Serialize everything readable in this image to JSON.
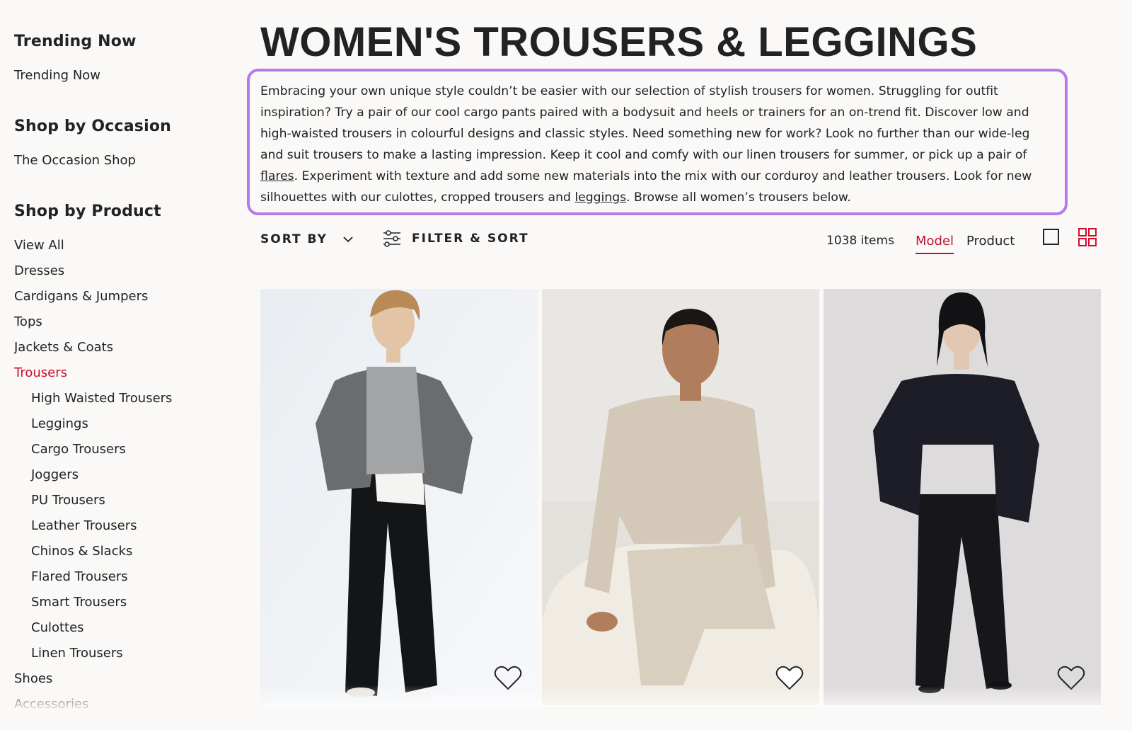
{
  "sidebar": {
    "sections": [
      {
        "heading": "Trending Now",
        "items": [
          "Trending Now"
        ]
      },
      {
        "heading": "Shop by Occasion",
        "items": [
          "The Occasion Shop"
        ]
      },
      {
        "heading": "Shop by Product",
        "items": [
          "View All",
          "Dresses",
          "Cardigans & Jumpers",
          "Tops",
          "Jackets & Coats",
          "Trousers"
        ]
      }
    ],
    "active_item": "Trousers",
    "sub_items": [
      "High Waisted Trousers",
      "Leggings",
      "Cargo Trousers",
      "Joggers",
      "PU Trousers",
      "Leather Trousers",
      "Chinos & Slacks",
      "Flared Trousers",
      "Smart Trousers",
      "Culottes",
      "Linen Trousers"
    ],
    "after_items": [
      "Shoes",
      "Accessories"
    ]
  },
  "page": {
    "title": "WOMEN'S TROUSERS & LEGGINGS",
    "description_part1": "Embracing your own unique style couldn’t be easier with our selection of stylish trousers for women. Struggling for outfit inspiration? Try a pair of our cool cargo pants paired with a bodysuit and heels or trainers for an on-trend fit. Discover low and high-waisted trousers in colourful designs and classic styles. Need something new for work? Look no further than our wide-leg and suit trousers to make a lasting impression. Keep it cool and comfy with our linen trousers for summer, or pick up a pair of ",
    "link_flares": "flares",
    "description_part2": ". Experiment with texture and add some new materials into the mix with our corduroy and leather trousers. Look for new silhouettes with our culottes, cropped trousers and ",
    "link_leggings": "leggings",
    "description_part3": ". Browse all women’s trousers below."
  },
  "toolbar": {
    "sort_label": "SORT BY",
    "filter_label": "FILTER & SORT",
    "item_count": "1038 items",
    "view_model": "Model",
    "view_product": "Product",
    "active_view": "Model",
    "active_layout": "grid"
  },
  "products": [
    {
      "outfit": "grey fleece bomber jacket, grey knit jumper, black wide trousers",
      "favourite": false
    },
    {
      "outfit": "beige knit jumper and matching trousers",
      "favourite": false
    },
    {
      "outfit": "navy oversized blazer, black flared trousers",
      "favourite": false
    }
  ],
  "colors": {
    "accent_red": "#c8102e",
    "highlight_purple": "#b57be6",
    "text": "#222222",
    "background": "#faf9f8"
  },
  "icons": {
    "sort": "chevron-down-icon",
    "filter": "sliders-icon",
    "single_view": "square-icon",
    "grid_view": "grid-icon",
    "favourite": "heart-icon"
  }
}
